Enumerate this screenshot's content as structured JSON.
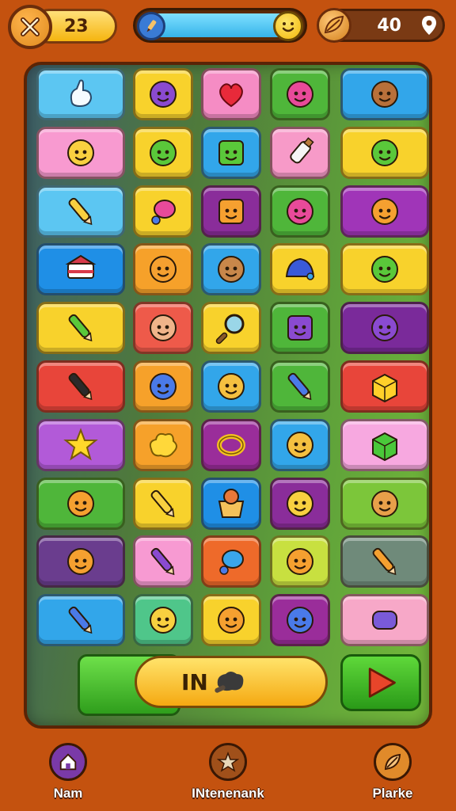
{
  "header": {
    "coins": "23",
    "score": "40",
    "level_progress": 1.0
  },
  "board": {
    "rows": [
      [
        {
          "color": "#5cc6f2",
          "icon": "hand-item-icon"
        },
        {
          "color": "#f8d22c",
          "icon": "purple-blob-face-icon"
        },
        {
          "color": "#f58cc4",
          "icon": "heart-icon"
        },
        {
          "color": "#4fb63a",
          "icon": "pink-potion-face-icon"
        },
        {
          "color": "#32a6ea",
          "icon": "monkey-face-icon"
        }
      ],
      [
        {
          "color": "#f89ad0",
          "icon": "yellow-cat-face-icon"
        },
        {
          "color": "#f8d22c",
          "icon": "green-bird-icon"
        },
        {
          "color": "#32a6ea",
          "icon": "green-cube-face-icon"
        },
        {
          "color": "#f79ac8",
          "icon": "bottle-icon"
        },
        {
          "color": "#f8d22c",
          "icon": "green-fish-face-icon"
        }
      ],
      [
        {
          "color": "#5cc6f2",
          "icon": "yellow-bone-icon"
        },
        {
          "color": "#f8d22c",
          "icon": "pink-gem-icon"
        },
        {
          "color": "#8a2d9a",
          "icon": "orange-box-face-icon"
        },
        {
          "color": "#4fb63a",
          "icon": "pink-mushroom-face-icon"
        },
        {
          "color": "#a035b8",
          "icon": "orange-bread-face-icon"
        }
      ],
      [
        {
          "color": "#1f8fe6",
          "icon": "red-cake-icon"
        },
        {
          "color": "#f6a12a",
          "icon": "orange-ball-face-icon"
        },
        {
          "color": "#32a6ea",
          "icon": "helmet-face-icon"
        },
        {
          "color": "#f8d22c",
          "icon": "blue-hat-icon"
        },
        {
          "color": "#f8d22c",
          "icon": "green-frog-face-icon"
        }
      ],
      [
        {
          "color": "#f8d22c",
          "icon": "green-pencil-icon"
        },
        {
          "color": "#ee5a4a",
          "icon": "girl-face-icon"
        },
        {
          "color": "#f8d22c",
          "icon": "magnifier-icon"
        },
        {
          "color": "#4fb63a",
          "icon": "purple-cube-face-icon"
        },
        {
          "color": "#7a2a9a",
          "icon": "purple-roll-face-icon"
        }
      ],
      [
        {
          "color": "#e8453a",
          "icon": "paintbrush-icon"
        },
        {
          "color": "#f6a12a",
          "icon": "blue-ball-face-icon"
        },
        {
          "color": "#32a6ea",
          "icon": "hat-face-icon"
        },
        {
          "color": "#4fb63a",
          "icon": "blue-pen-icon"
        },
        {
          "color": "#e8453a",
          "icon": "star-cube-icon"
        }
      ],
      [
        {
          "color": "#b25ad8",
          "icon": "yellow-star-icon"
        },
        {
          "color": "#f6a12a",
          "icon": "yellow-splat-icon"
        },
        {
          "color": "#9a2d9a",
          "icon": "gold-ring-icon"
        },
        {
          "color": "#32a6ea",
          "icon": "orange-hat-face-icon"
        },
        {
          "color": "#f7a8e0",
          "icon": "green-cube-icon"
        }
      ],
      [
        {
          "color": "#4fb63a",
          "icon": "orange-ball-face-icon"
        },
        {
          "color": "#f8d22c",
          "icon": "crayon-icon"
        },
        {
          "color": "#1f8fe6",
          "icon": "basket-icon"
        },
        {
          "color": "#8a2d9a",
          "icon": "yellow-smiley-icon"
        },
        {
          "color": "#7cc63a",
          "icon": "acorn-face-icon"
        }
      ],
      [
        {
          "color": "#6a3d8e",
          "icon": "orange-ball-face-icon"
        },
        {
          "color": "#f79ad2",
          "icon": "purple-crayon-icon"
        },
        {
          "color": "#ee6a2a",
          "icon": "blue-gem-icon"
        },
        {
          "color": "#c8e040",
          "icon": "orange-smiley-icon"
        },
        {
          "color": "#6f8a7a",
          "icon": "orange-pencil-icon"
        }
      ],
      [
        {
          "color": "#32a6ea",
          "icon": "blue-tube-icon"
        },
        {
          "color": "#4fc68a",
          "icon": "yellow-smiley-icon"
        },
        {
          "color": "#f8d22c",
          "icon": "orange-smiley-icon"
        },
        {
          "color": "#9a2d9a",
          "icon": "blue-smiley-icon"
        },
        {
          "color": "#f7a8c8",
          "icon": "purple-roll-icon"
        }
      ]
    ]
  },
  "controls": {
    "in_button_label": "IN",
    "play_icon": "play-triangle-icon"
  },
  "nav": [
    {
      "label": "Nam",
      "icon": "home-icon",
      "color": "#7a3aa8"
    },
    {
      "label": "INtenenank",
      "icon": "star-icon",
      "color": "#a0501a"
    },
    {
      "label": "Plarke",
      "icon": "leaf-icon",
      "color": "#e08a2a"
    }
  ],
  "colors": {
    "background": "#c4520f",
    "board_border": "#5a2406",
    "accent_yellow": "#f5b50f",
    "accent_green": "#2f9e1c"
  }
}
